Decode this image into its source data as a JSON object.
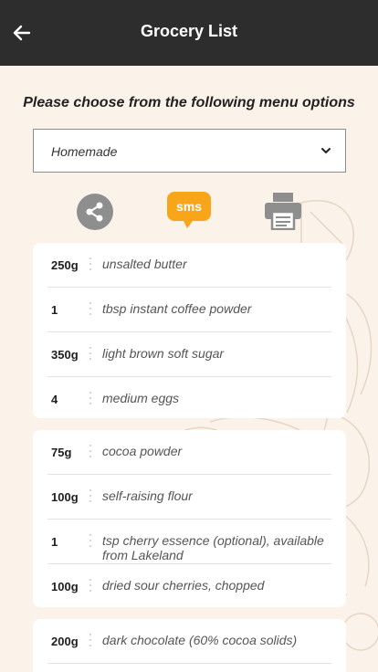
{
  "header": {
    "title": "Grocery List",
    "back_icon": "arrow-left-icon"
  },
  "prompt": "Please choose from the following menu options",
  "menu_select": {
    "value": "Homemade",
    "icon": "chevron-down-icon"
  },
  "actions": [
    {
      "name": "share",
      "icon": "share-icon"
    },
    {
      "name": "sms",
      "label": "sms",
      "icon": "sms-bubble-icon"
    },
    {
      "name": "print",
      "icon": "printer-icon"
    }
  ],
  "colors": {
    "header_bg": "#2d2d2d",
    "sms_accent": "#f9a51a",
    "background": "#fbf3ea"
  },
  "cards": [
    {
      "items": [
        {
          "qty": "250g",
          "desc": "unsalted butter"
        },
        {
          "qty": "1",
          "desc": "tbsp instant coffee powder"
        },
        {
          "qty": "350g",
          "desc": "light brown soft sugar"
        },
        {
          "qty": "4",
          "desc": "medium eggs"
        }
      ]
    },
    {
      "items": [
        {
          "qty": "75g",
          "desc": "cocoa powder"
        },
        {
          "qty": "100g",
          "desc": "self-raising flour"
        },
        {
          "qty": "1",
          "desc": "tsp cherry essence (optional), available from Lakeland"
        },
        {
          "qty": "100g",
          "desc": "dried sour cherries, chopped"
        }
      ]
    },
    {
      "items": [
        {
          "qty": "200g",
          "desc": "dark chocolate (60% cocoa solids)"
        }
      ]
    }
  ]
}
